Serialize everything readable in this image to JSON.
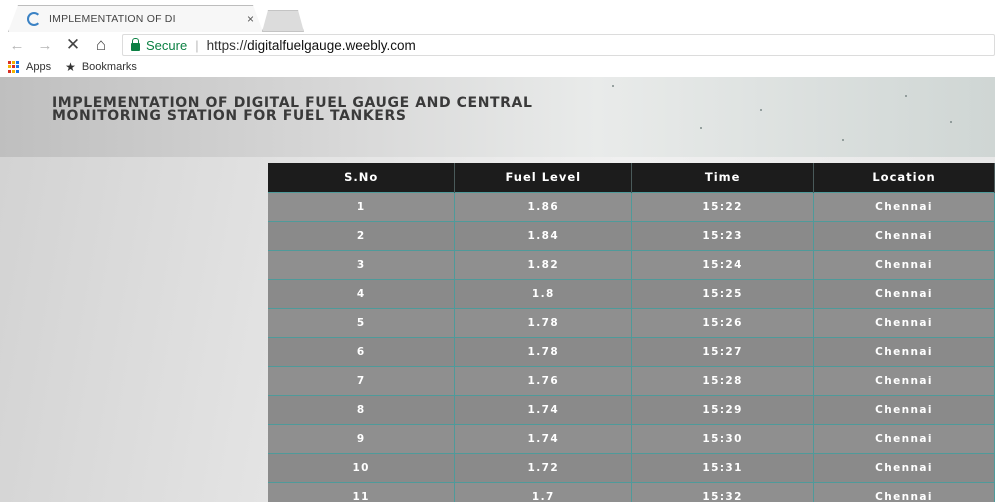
{
  "browser": {
    "tab_title": "IMPLEMENTATION OF DI",
    "tab_close": "×",
    "secure_label": "Secure",
    "url_scheme": "https://",
    "url_host": "digitalfuelgauge.weebly.com",
    "bookmarks": {
      "apps_label": "Apps",
      "bookmarks_label": "Bookmarks"
    }
  },
  "page": {
    "title": "IMPLEMENTATION OF DIGITAL FUEL GAUGE AND CENTRAL MONITORING STATION FOR FUEL TANKERS"
  },
  "table": {
    "headers": [
      "S.No",
      "Fuel Level",
      "Time",
      "Location"
    ],
    "rows": [
      [
        "1",
        "1.86",
        "15:22",
        "Chennai"
      ],
      [
        "2",
        "1.84",
        "15:23",
        "Chennai"
      ],
      [
        "3",
        "1.82",
        "15:24",
        "Chennai"
      ],
      [
        "4",
        "1.8",
        "15:25",
        "Chennai"
      ],
      [
        "5",
        "1.78",
        "15:26",
        "Chennai"
      ],
      [
        "6",
        "1.78",
        "15:27",
        "Chennai"
      ],
      [
        "7",
        "1.76",
        "15:28",
        "Chennai"
      ],
      [
        "8",
        "1.74",
        "15:29",
        "Chennai"
      ],
      [
        "9",
        "1.74",
        "15:30",
        "Chennai"
      ],
      [
        "10",
        "1.72",
        "15:31",
        "Chennai"
      ],
      [
        "11",
        "1.7",
        "15:32",
        "Chennai"
      ]
    ]
  },
  "colors": {
    "header_bg": "#1c1c1c",
    "cell_bg": "#8f8f8f",
    "grid_line": "#4f9a9a",
    "secure_green": "#0b8043"
  }
}
